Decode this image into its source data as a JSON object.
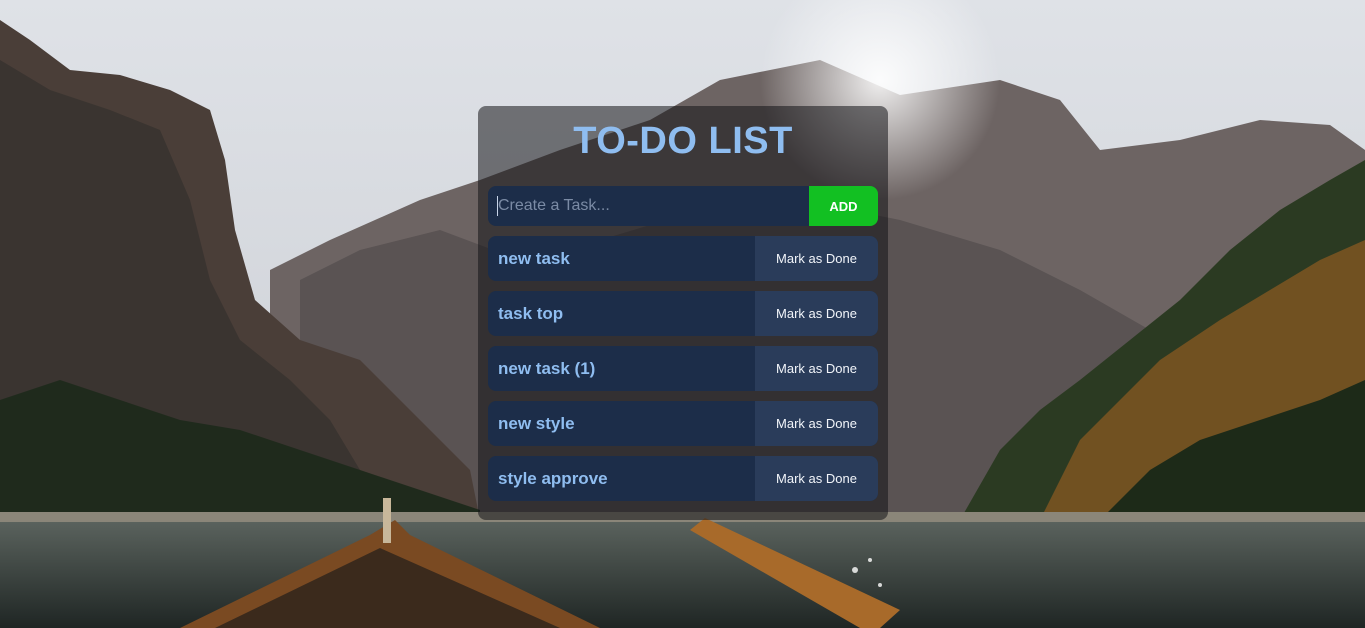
{
  "app": {
    "title": "TO-DO LIST"
  },
  "input": {
    "placeholder": "Create a Task...",
    "value": "",
    "add_label": "ADD"
  },
  "tasks": [
    {
      "text": "new task",
      "action_label": "Mark as Done"
    },
    {
      "text": "task top",
      "action_label": "Mark as Done"
    },
    {
      "text": "new task (1)",
      "action_label": "Mark as Done"
    },
    {
      "text": "new style",
      "action_label": "Mark as Done"
    },
    {
      "text": "style approve",
      "action_label": "Mark as Done"
    }
  ],
  "colors": {
    "title": "#8fbdf0",
    "add_button": "#12c022",
    "task_background": "#1c2d49",
    "done_button": "#2a3c5a"
  },
  "background": {
    "icon": "mountain-lake-boat-photo"
  }
}
